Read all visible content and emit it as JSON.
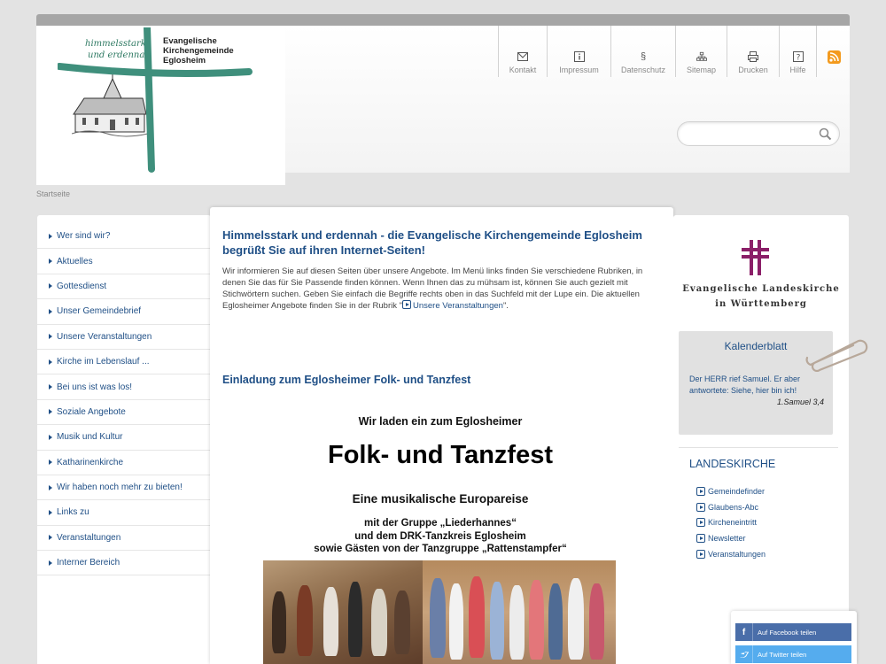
{
  "logo": {
    "hand_line1": "himmelsstark",
    "hand_line2": "und erdennah",
    "title_line1": "Evangelische",
    "title_line2": "Kirchengemeinde",
    "title_line3": "Eglosheim",
    "cross_color": "#3f8f7c"
  },
  "toolbar": [
    {
      "label": "Kontakt",
      "icon": "envelope-icon"
    },
    {
      "label": "Impressum",
      "icon": "info-icon"
    },
    {
      "label": "Datenschutz",
      "icon": "paragraph-icon"
    },
    {
      "label": "Sitemap",
      "icon": "sitemap-icon"
    },
    {
      "label": "Drucken",
      "icon": "printer-icon"
    },
    {
      "label": "Hilfe",
      "icon": "help-icon"
    }
  ],
  "search": {
    "placeholder": ""
  },
  "breadcrumb": "Startseite",
  "nav": [
    "Wer sind wir?",
    "Aktuelles",
    "Gottesdienst",
    "Unser Gemeindebrief",
    "Unsere Veranstaltungen",
    "Kirche im Lebenslauf ...",
    "Bei uns ist was los!",
    "Soziale Angebote",
    "Musik und Kultur",
    "Katharinenkirche",
    "Wir haben noch mehr zu bieten!",
    "Links zu",
    "Veranstaltungen",
    "Interner Bereich"
  ],
  "main": {
    "heading": "Himmelsstark und erdennah - die Evangelische Kirchengemeinde Eglosheim begrüßt Sie auf ihren Internet-Seiten!",
    "intro_text": "Wir informieren Sie auf diesen Seiten über unsere Angebote. Im Menü links finden Sie verschiedene Rubriken, in denen Sie das für Sie Passende finden können. Wenn Ihnen das zu mühsam ist, können Sie auch gezielt mit Stichwörtern suchen. Geben Sie einfach die Begriffe rechts oben in das Suchfeld mit der Lupe ein. Die aktuellen Eglosheimer Angebote finden Sie in der Rubrik \"",
    "intro_link": "Unsere Veranstaltungen",
    "intro_end": "\".",
    "subheading": "Einladung zum Eglosheimer Folk- und Tanzfest",
    "poster": {
      "line1": "Wir laden ein zum Eglosheimer",
      "line2": "Folk- und Tanzfest",
      "line3": "Eine musikalische Europareise",
      "line4": "mit der Gruppe „Liederhannes“",
      "line5": "und dem DRK-Tanzkreis Eglosheim",
      "line6": "sowie Gästen von der Tanzgruppe „Rattenstampfer“"
    }
  },
  "landeskirche": {
    "line1": "Evangelische Landeskirche",
    "line2": "in Württemberg",
    "cross_color": "#8b1f68"
  },
  "kalender": {
    "title": "Kalenderblatt",
    "verse": "Der HERR rief Samuel. Er aber antwortete: Siehe, hier bin ich!",
    "reference": "1.Samuel 3,4"
  },
  "landeskirche_links": {
    "heading": "LANDESKIRCHE",
    "items": [
      "Gemeindefinder",
      "Glaubens-Abc",
      "Kircheneintritt",
      "Newsletter",
      "Veranstaltungen"
    ]
  },
  "share": {
    "facebook": "Auf Facebook teilen",
    "twitter": "Auf Twitter teilen"
  }
}
